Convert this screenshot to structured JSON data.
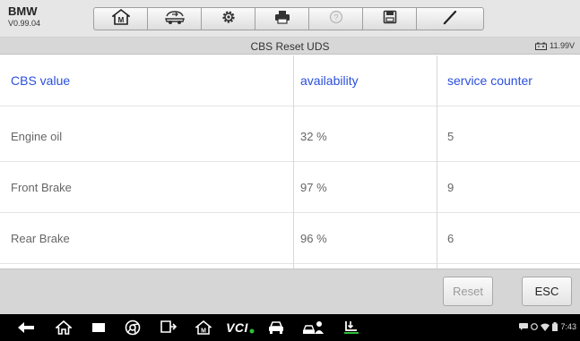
{
  "header": {
    "brand": "BMW",
    "version": "V0.99.04",
    "tools": [
      {
        "name": "home-icon"
      },
      {
        "name": "vehicle-swap-icon"
      },
      {
        "name": "settings-icon"
      },
      {
        "name": "print-icon"
      },
      {
        "name": "help-icon"
      },
      {
        "name": "save-icon"
      },
      {
        "name": "pen-icon"
      }
    ]
  },
  "titlebar": {
    "title": "CBS Reset UDS",
    "battery": "11.99V"
  },
  "table": {
    "columns": [
      "CBS value",
      "availability",
      "service counter"
    ],
    "rows": [
      [
        "Engine oil",
        "32 %",
        "5"
      ],
      [
        "Front Brake",
        "97 %",
        "9"
      ],
      [
        "Rear Brake",
        "96 %",
        "6"
      ]
    ]
  },
  "buttons": {
    "reset": "Reset",
    "esc": "ESC"
  },
  "navbar": {
    "vci": "VCI",
    "time": "7:43"
  },
  "colors": {
    "header_text": "#2a4fdc",
    "vci_dot": "#2fbf3a",
    "toolbar_bg": "#e6e6e6"
  }
}
